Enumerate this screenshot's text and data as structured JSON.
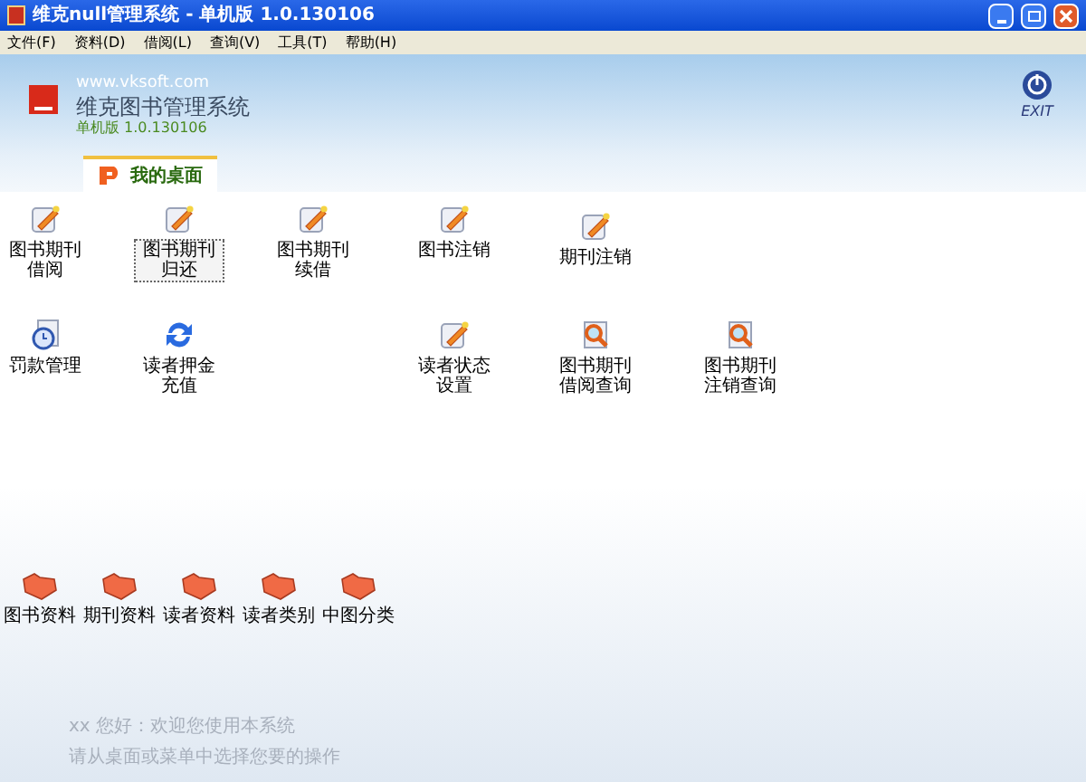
{
  "window": {
    "title": "维克null管理系统 - 单机版 1.0.130106"
  },
  "menu": [
    "文件(F)",
    "资料(D)",
    "借阅(L)",
    "查询(V)",
    "工具(T)",
    "帮助(H)"
  ],
  "header": {
    "url": "www.vksoft.com",
    "title": "维克图书管理系统",
    "version": "单机版 1.0.130106",
    "exit": "EXIT"
  },
  "tabs": [
    {
      "label": "我的桌面",
      "selected": true
    }
  ],
  "desktop_icons": [
    {
      "label": "图书期刊借阅",
      "kind": "edit",
      "selected": false
    },
    {
      "label": "图书期刊归还",
      "kind": "edit",
      "selected": true
    },
    {
      "label": "图书期刊续借",
      "kind": "edit",
      "selected": false
    },
    {
      "label": "图书注销",
      "kind": "edit",
      "selected": false
    },
    {
      "label": "期刊注销",
      "kind": "edit",
      "selected": false
    },
    {
      "label": "罚款管理",
      "kind": "clock",
      "selected": false
    },
    {
      "label": "读者押金充值",
      "kind": "refresh",
      "selected": false
    },
    {
      "label": "读者状态设置",
      "kind": "edit",
      "selected": false
    },
    {
      "label": "图书期刊借阅查询",
      "kind": "search",
      "selected": false
    },
    {
      "label": "图书期刊注销查询",
      "kind": "search",
      "selected": false
    },
    {
      "label": "图书资料",
      "kind": "folder",
      "selected": false
    },
    {
      "label": "期刊资料",
      "kind": "folder",
      "selected": false
    },
    {
      "label": "读者资料",
      "kind": "folder",
      "selected": false
    },
    {
      "label": "读者类别",
      "kind": "folder",
      "selected": false
    },
    {
      "label": "中图分类",
      "kind": "folder",
      "selected": false
    }
  ],
  "status": [
    "xx 您好：欢迎您使用本系统",
    "请从桌面或菜单中选择您要的操作"
  ]
}
